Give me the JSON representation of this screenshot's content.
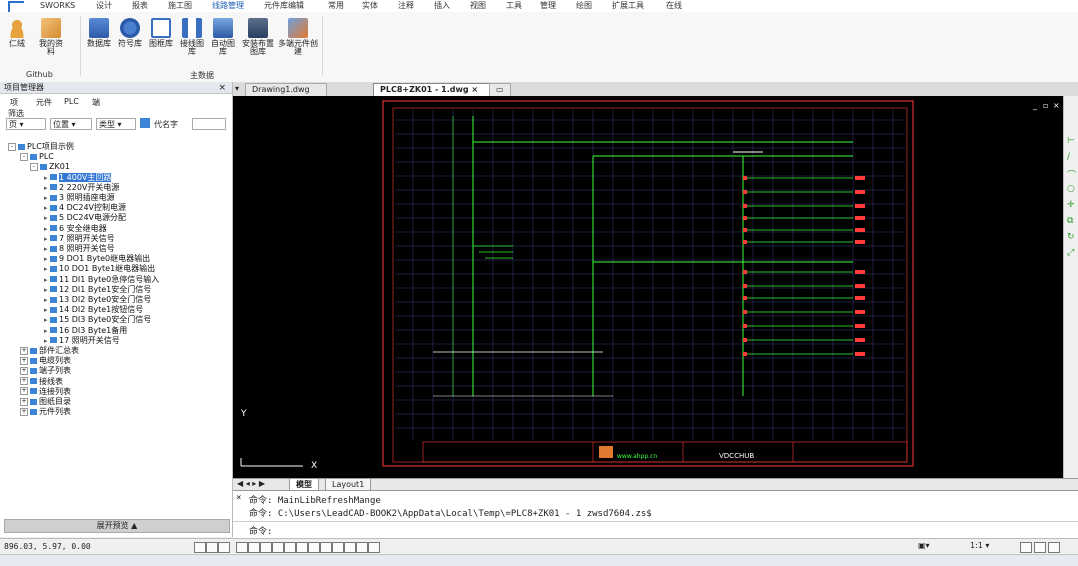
{
  "menu": {
    "app_button": "SWORKS",
    "items": [
      "设计",
      "报表",
      "施工图",
      "线路管理",
      "元件库编辑",
      "常用",
      "实体",
      "注释",
      "插入",
      "视图",
      "工具",
      "管理",
      "绘图",
      "扩展工具",
      "在线"
    ],
    "active_index": 3
  },
  "ribbon": {
    "groups": [
      {
        "label": "Github",
        "buttons": [
          "仁绒",
          "我的资料"
        ]
      },
      {
        "label": "主数据",
        "buttons": [
          "数据库",
          "符号库",
          "图框库",
          "接线图库",
          "自动图库",
          "安装布置图库",
          "多端元件创建"
        ]
      }
    ]
  },
  "project_panel": {
    "title": "项目管理器",
    "close": "×",
    "tabs": [
      "项",
      "元件",
      "PLC",
      "端"
    ],
    "filter_label": "筛选",
    "filters": {
      "first": "页",
      "second": "位置",
      "third": "类型",
      "search_placeholder": "代名字"
    },
    "tree": [
      {
        "level": 0,
        "label": "PLC项目示例",
        "expand": "-"
      },
      {
        "level": 1,
        "label": "PLC",
        "expand": "-"
      },
      {
        "level": 2,
        "label": "ZK01",
        "expand": "-"
      },
      {
        "level": 3,
        "label": "1 400V主回路",
        "selected": true
      },
      {
        "level": 3,
        "label": "2 220V开关电源"
      },
      {
        "level": 3,
        "label": "3 照明插座电源"
      },
      {
        "level": 3,
        "label": "4 DC24V控制电源"
      },
      {
        "level": 3,
        "label": "5 DC24V电源分配"
      },
      {
        "level": 3,
        "label": "6 安全继电器"
      },
      {
        "level": 3,
        "label": "7 照明开关信号"
      },
      {
        "level": 3,
        "label": "8 照明开关信号"
      },
      {
        "level": 3,
        "label": "9 DO1 Byte0继电器输出"
      },
      {
        "level": 3,
        "label": "10 DO1 Byte1继电器输出"
      },
      {
        "level": 3,
        "label": "11 DI1 Byte0急停信号输入"
      },
      {
        "level": 3,
        "label": "12 DI1 Byte1安全门信号"
      },
      {
        "level": 3,
        "label": "13 DI2 Byte0安全门信号"
      },
      {
        "level": 3,
        "label": "14 DI2 Byte1按钮信号"
      },
      {
        "level": 3,
        "label": "15 DI3 Byte0安全门信号"
      },
      {
        "level": 3,
        "label": "16 DI3 Byte1备用"
      },
      {
        "level": 3,
        "label": "17 照明开关信号"
      },
      {
        "level": 1,
        "label": "部件汇总表",
        "expand": "+"
      },
      {
        "level": 1,
        "label": "电缆列表",
        "expand": "+"
      },
      {
        "level": 1,
        "label": "端子列表",
        "expand": "+"
      },
      {
        "level": 1,
        "label": "接线表",
        "expand": "+"
      },
      {
        "level": 1,
        "label": "连接列表",
        "expand": "+"
      },
      {
        "level": 1,
        "label": "图纸目录",
        "expand": "+"
      },
      {
        "level": 1,
        "label": "元件列表",
        "expand": "+"
      }
    ],
    "bottom_button": "展开预览 ▲"
  },
  "doc_tabs": [
    {
      "label": "Drawing1.dwg",
      "active": false
    },
    {
      "label": "PLC8+ZK01 - 1.dwg",
      "active": true
    }
  ],
  "layout_tabs": [
    "模型",
    "Layout1"
  ],
  "command": {
    "lines": [
      "命令: MainLibRefreshMange",
      "命令: C:\\Users\\LeadCAD-BOOK2\\AppData\\Local\\Temp\\=PLC8+ZK01 - 1 zwsd7604.zs$"
    ],
    "prompt": "命令:"
  },
  "status": {
    "coords": "896.03, 5.97, 0.00",
    "scale": "1:1"
  },
  "drawing": {
    "title_block_text": "VDCCHUB",
    "logo_text": "www.ahpp.cn"
  },
  "colors": {
    "canvas_bg": "#000000",
    "frame": "#ff3b3b",
    "wire": "#3cff3c",
    "grid": "#3a3a7a",
    "accent": "#2a6fc9",
    "selection": "#3478d4"
  }
}
